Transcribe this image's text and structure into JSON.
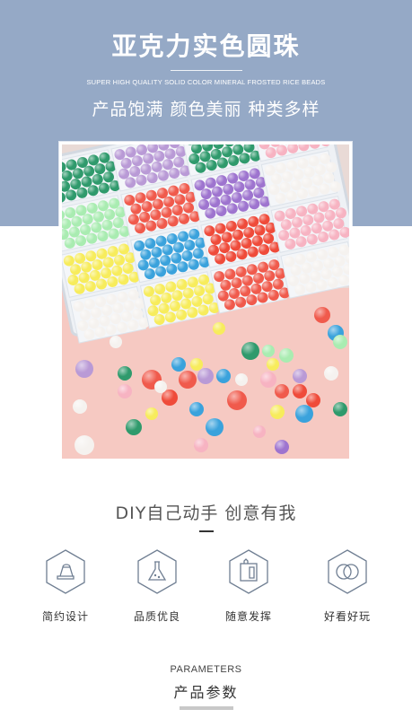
{
  "header": {
    "title": "亚克力实色圆珠",
    "subtitle_en": "SUPER HIGH QUALITY SOLID COLOR MINERAL FROSTED RICE BEADS",
    "tagline": "产品饱满 颜色美丽 种类多样",
    "background_color": "#95a9c6"
  },
  "photo": {
    "icon": "product-photo",
    "bead_colors": [
      "#2f9a6c",
      "#b99ad6",
      "#a9ecb1",
      "#f05a4c",
      "#9e74cf",
      "#f7b3c2",
      "#f7ec5c",
      "#3aa2dc",
      "#ef4b3a",
      "#f5f2ef"
    ]
  },
  "diy": {
    "heading": "DIY自己动手 创意有我"
  },
  "features": [
    {
      "label": "简约设计",
      "icon": "design-icon"
    },
    {
      "label": "品质优良",
      "icon": "flask-icon"
    },
    {
      "label": "随意发挥",
      "icon": "creativity-icon"
    },
    {
      "label": "好看好玩",
      "icon": "fun-icon"
    }
  ],
  "params": {
    "heading_en": "PARAMETERS",
    "heading_cn": "产品参数"
  }
}
